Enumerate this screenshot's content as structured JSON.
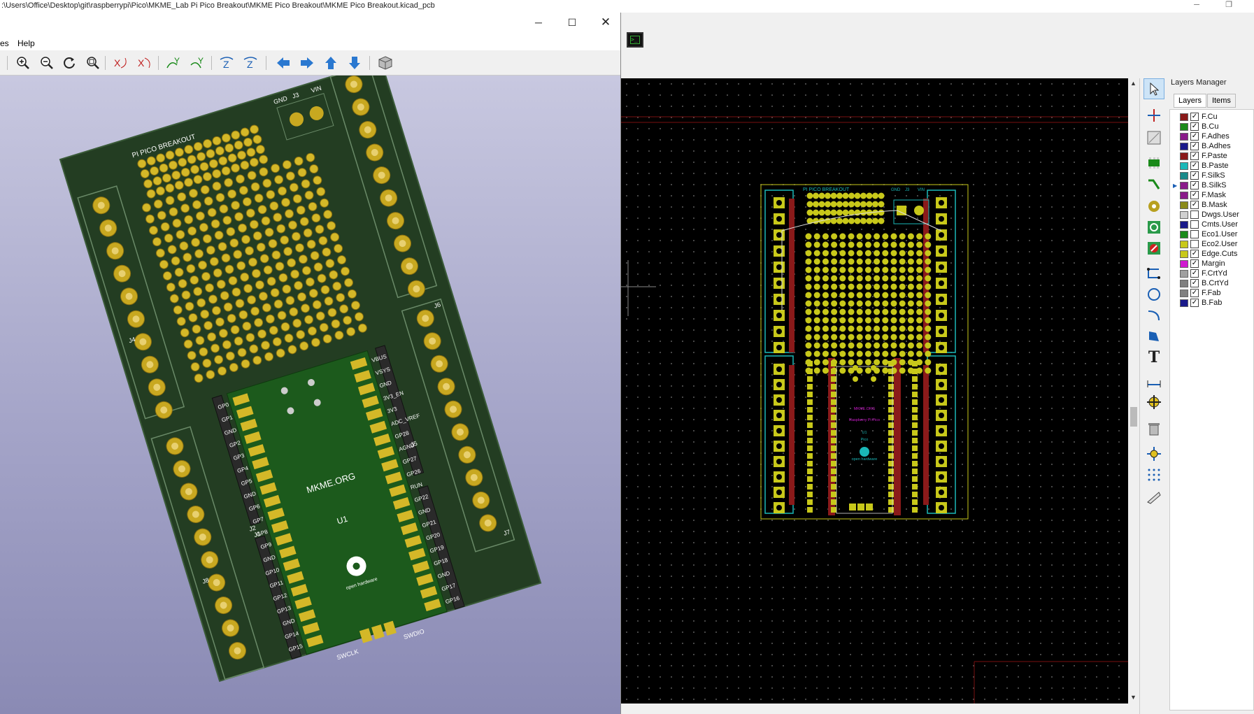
{
  "main_window": {
    "title": ":\\Users\\Office\\Desktop\\git\\raspberrypi\\Pico\\MKME_Lab Pi Pico Breakout\\MKME Pico Breakout\\MKME Pico Breakout.kicad_pcb"
  },
  "viewer": {
    "menu": [
      "es",
      "Help"
    ],
    "toolbar_icons": [
      "zoom-in-icon",
      "zoom-out-icon",
      "redraw-icon",
      "zoom-fit-icon",
      "rotate-x-cw-icon",
      "rotate-x-ccw-icon",
      "rotate-y-cw-icon",
      "rotate-y-ccw-icon",
      "rotate-z-cw-icon",
      "rotate-z-ccw-icon",
      "pan-left-icon",
      "pan-right-icon",
      "pan-up-icon",
      "pan-down-icon",
      "ortho-3d-icon"
    ],
    "board": {
      "title_silk": "PI PICO BREAKOUT",
      "j3_labels": [
        "GND",
        "J3",
        "VIN"
      ],
      "center_text": "MKME.ORG",
      "u1": "U1",
      "oshw_text": "open hardware",
      "left_pins": [
        "GP0",
        "GP1",
        "GND",
        "GP2",
        "GP3",
        "GP4",
        "GP5",
        "GND",
        "GP6",
        "GP7",
        "GP8",
        "GP9",
        "GND",
        "GP10",
        "GP11",
        "GP12",
        "GP13",
        "GND",
        "GP14",
        "GP15"
      ],
      "right_pins": [
        "VBUS",
        "VSYS",
        "GND",
        "3V3_EN",
        "3V3",
        "ADC_VREF",
        "GP28",
        "AGND",
        "GP27",
        "GP26",
        "RUN",
        "GP22",
        "GND",
        "GP21",
        "GP20",
        "GP19",
        "GP18",
        "GND",
        "GP17",
        "GP16"
      ],
      "connector_labels": [
        "J2",
        "J1",
        "J4",
        "J5",
        "J6",
        "J7",
        "J8"
      ],
      "swclk": "SWCLK",
      "swdio": "SWDIO"
    }
  },
  "pcb_editor": {
    "board": {
      "title_silk": "PI PICO BREAKOUT",
      "j3_labels": [
        "GND",
        "J3",
        "VIN"
      ],
      "fab_lines": [
        "MKME.ORG",
        "Raspberry Pi Pico",
        "U1",
        "Pico",
        "open hardware"
      ]
    }
  },
  "layers_manager": {
    "title": "Layers Manager",
    "tabs": [
      "Layers",
      "Items"
    ],
    "layers": [
      {
        "name": "F.Cu",
        "color": "#8a1a1a",
        "visible": true
      },
      {
        "name": "B.Cu",
        "color": "#1a8a1a",
        "visible": true
      },
      {
        "name": "F.Adhes",
        "color": "#8a1a8a",
        "visible": true
      },
      {
        "name": "B.Adhes",
        "color": "#1a1a8a",
        "visible": true
      },
      {
        "name": "F.Paste",
        "color": "#8a1a1a",
        "visible": true
      },
      {
        "name": "B.Paste",
        "color": "#1ab8b8",
        "visible": true
      },
      {
        "name": "F.SilkS",
        "color": "#1a8a8a",
        "visible": true
      },
      {
        "name": "B.SilkS",
        "color": "#8a1a8a",
        "visible": true,
        "active": true
      },
      {
        "name": "F.Mask",
        "color": "#8a1a8a",
        "visible": true
      },
      {
        "name": "B.Mask",
        "color": "#8a8a1a",
        "visible": true
      },
      {
        "name": "Dwgs.User",
        "color": "#d0d0d0",
        "visible": false
      },
      {
        "name": "Cmts.User",
        "color": "#1a1a8a",
        "visible": false
      },
      {
        "name": "Eco1.User",
        "color": "#1a8a1a",
        "visible": false
      },
      {
        "name": "Eco2.User",
        "color": "#c8c81a",
        "visible": false
      },
      {
        "name": "Edge.Cuts",
        "color": "#c8c81a",
        "visible": true
      },
      {
        "name": "Margin",
        "color": "#d01ad0",
        "visible": true
      },
      {
        "name": "F.CrtYd",
        "color": "#a0a0a0",
        "visible": true
      },
      {
        "name": "B.CrtYd",
        "color": "#808080",
        "visible": true
      },
      {
        "name": "F.Fab",
        "color": "#808080",
        "visible": true
      },
      {
        "name": "B.Fab",
        "color": "#1a1a8a",
        "visible": true
      }
    ]
  },
  "right_toolbar_icons": [
    "select-arrow-icon",
    "highlight-net-icon",
    "local-ratsnest-icon",
    "add-footprint-icon",
    "route-track-icon",
    "add-via-icon",
    "add-zone-icon",
    "add-keepout-icon",
    "draw-line-icon",
    "draw-circle-icon",
    "draw-arc-icon",
    "draw-polygon-icon",
    "add-text-icon",
    "add-dimension-icon",
    "add-target-icon",
    "delete-icon",
    "set-origin-icon",
    "grid-origin-icon",
    "measure-icon"
  ]
}
